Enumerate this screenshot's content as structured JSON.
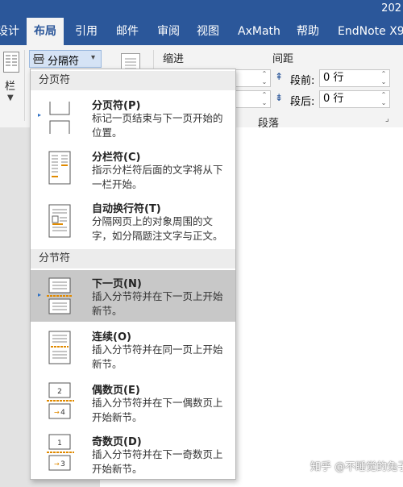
{
  "title": {
    "year_fragment": "202"
  },
  "tabs": [
    {
      "label": "设计",
      "active": false
    },
    {
      "label": "布局",
      "active": true
    },
    {
      "label": "引用",
      "active": false
    },
    {
      "label": "邮件",
      "active": false
    },
    {
      "label": "审阅",
      "active": false
    },
    {
      "label": "视图",
      "active": false
    },
    {
      "label": "AxMath",
      "active": false
    },
    {
      "label": "帮助",
      "active": false
    },
    {
      "label": "EndNote X9",
      "active": false
    }
  ],
  "ribbon": {
    "columns_label": "栏",
    "breaks_label": "分隔符",
    "indent_label": "缩进",
    "spacing_label": "间距",
    "paragraph_label": "段落",
    "spacing_before_label": "段前:",
    "spacing_before_value": "0 行",
    "spacing_after_label": "段后:",
    "spacing_after_value": "0 行"
  },
  "dropdown": {
    "page_breaks_header": "分页符",
    "section_breaks_header": "分节符",
    "items": [
      {
        "title": "分页符(P)",
        "desc": "标记一页结束与下一页开始的位置。"
      },
      {
        "title": "分栏符(C)",
        "desc": "指示分栏符后面的文字将从下一栏开始。"
      },
      {
        "title": "自动换行符(T)",
        "desc": "分隔网页上的对象周围的文字，如分隔题注文字与正文。"
      },
      {
        "title": "下一页(N)",
        "desc": "插入分节符并在下一页上开始新节。",
        "highlight": true
      },
      {
        "title": "连续(O)",
        "desc": "插入分节符并在同一页上开始新节。"
      },
      {
        "title": "偶数页(E)",
        "desc": "插入分节符并在下一偶数页上开始新节。"
      },
      {
        "title": "奇数页(D)",
        "desc": "插入分节符并在下一奇数页上开始新节。"
      }
    ],
    "even_icon_numbers": [
      "2",
      "4"
    ],
    "odd_icon_numbers": [
      "1",
      "3"
    ]
  },
  "watermark": "知乎 @不睡觉的兔子",
  "colors": {
    "accent": "#2b579a",
    "highlight": "#c8c8c8",
    "menu_header": "#ececec"
  }
}
